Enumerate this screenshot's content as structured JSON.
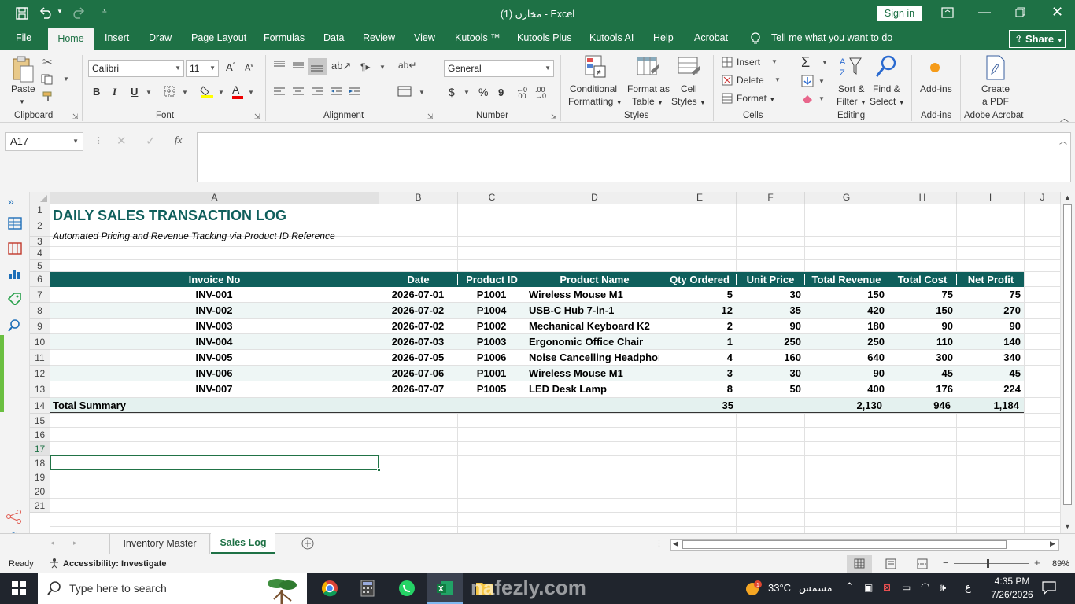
{
  "window": {
    "title": "مخازن (1)  -  Excel",
    "sign_in": "Sign in",
    "share": "Share"
  },
  "ribbon_tabs": [
    "File",
    "Home",
    "Insert",
    "Draw",
    "Page Layout",
    "Formulas",
    "Data",
    "Review",
    "View",
    "Kutools ™",
    "Kutools Plus",
    "Kutools AI",
    "Help",
    "Acrobat"
  ],
  "tell_me": "Tell me what you want to do",
  "ribbon": {
    "paste": "Paste",
    "font_name": "Calibri",
    "font_size": "11",
    "number_format": "General",
    "conditional": [
      "Conditional",
      "Formatting"
    ],
    "format_table": [
      "Format as",
      "Table"
    ],
    "cell_styles": [
      "Cell",
      "Styles"
    ],
    "insert": "Insert",
    "delete": "Delete",
    "format": "Format",
    "sort_filter": [
      "Sort &",
      "Filter"
    ],
    "find_select": [
      "Find &",
      "Select"
    ],
    "addins": "Add-ins",
    "create_pdf": [
      "Create",
      "a PDF"
    ],
    "groups": {
      "clipboard": "Clipboard",
      "font": "Font",
      "alignment": "Alignment",
      "number": "Number",
      "styles": "Styles",
      "cells": "Cells",
      "editing": "Editing",
      "addins": "Add-ins",
      "acrobat": "Adobe Acrobat"
    }
  },
  "formula_bar": {
    "name_box": "A17",
    "fx": "fx",
    "content": ""
  },
  "columns": [
    "A",
    "B",
    "C",
    "D",
    "E",
    "F",
    "G",
    "H",
    "I",
    "J"
  ],
  "rows": [
    "1",
    "2",
    "3",
    "4",
    "5",
    "6",
    "7",
    "8",
    "9",
    "10",
    "11",
    "12",
    "13",
    "14",
    "15",
    "16",
    "17",
    "18",
    "19",
    "20",
    "21"
  ],
  "sheet": {
    "title": "DAILY SALES TRANSACTION LOG",
    "subtitle": "Automated Pricing and Revenue Tracking via Product ID Reference",
    "headers": [
      "Invoice No",
      "Date",
      "Product ID",
      "Product Name",
      "Qty Ordered",
      "Unit Price",
      "Total Revenue",
      "Total Cost",
      "Net Profit"
    ],
    "data": [
      [
        "INV-001",
        "2026-07-01",
        "P1001",
        "Wireless Mouse M1",
        "5",
        "30",
        "150",
        "75",
        "75"
      ],
      [
        "INV-002",
        "2026-07-02",
        "P1004",
        "USB-C Hub 7-in-1",
        "12",
        "35",
        "420",
        "150",
        "270"
      ],
      [
        "INV-003",
        "2026-07-02",
        "P1002",
        "Mechanical Keyboard K2",
        "2",
        "90",
        "180",
        "90",
        "90"
      ],
      [
        "INV-004",
        "2026-07-03",
        "P1003",
        "Ergonomic Office Chair",
        "1",
        "250",
        "250",
        "110",
        "140"
      ],
      [
        "INV-005",
        "2026-07-05",
        "P1006",
        "Noise Cancelling Headphones",
        "4",
        "160",
        "640",
        "300",
        "340"
      ],
      [
        "INV-006",
        "2026-07-06",
        "P1001",
        "Wireless Mouse M1",
        "3",
        "30",
        "90",
        "45",
        "45"
      ],
      [
        "INV-007",
        "2026-07-07",
        "P1005",
        "LED Desk Lamp",
        "8",
        "50",
        "400",
        "176",
        "224"
      ]
    ],
    "total_label": "Total Summary",
    "totals": {
      "qty": "35",
      "revenue": "2,130",
      "cost": "946",
      "profit": "1,184"
    }
  },
  "sheet_tabs": [
    "Inventory Master",
    "Sales Log"
  ],
  "active_sheet": "Sales Log",
  "status": {
    "ready": "Ready",
    "accessibility": "Accessibility: Investigate",
    "zoom": "89%"
  },
  "taskbar": {
    "search": "Type here to search",
    "weather_temp": "33°C",
    "weather_desc": "مشمس",
    "lang": "ع",
    "time": "4:35 PM",
    "date": "7/26/2026"
  },
  "watermark": "nafezly.com",
  "colors": {
    "excel_green": "#1e7145",
    "header_teal": "#0f5f5c",
    "title_teal": "#0f5f5c",
    "zebra": "#eef6f5"
  }
}
